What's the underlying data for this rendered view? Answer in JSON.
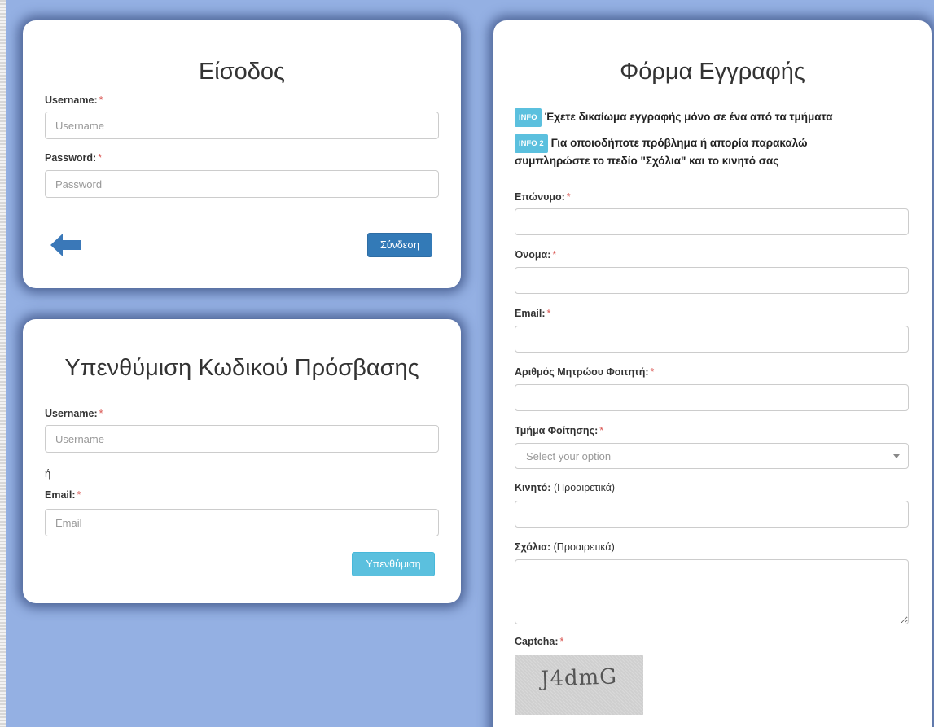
{
  "login": {
    "title": "Είσοδος",
    "username_label": "Username:",
    "username_placeholder": "Username",
    "password_label": "Password:",
    "password_placeholder": "Password",
    "submit_label": "Σύνδεση",
    "required_mark": "*"
  },
  "reminder": {
    "title": "Υπενθύμιση Κωδικού Πρόσβασης",
    "username_label": "Username:",
    "username_placeholder": "Username",
    "or_text": "ή",
    "email_label": "Email:",
    "email_placeholder": "Email",
    "submit_label": "Υπενθύμιση",
    "required_mark": "*"
  },
  "register": {
    "title": "Φόρμα Εγγραφής",
    "info1_badge": "INFO",
    "info1_text": "Έχετε δικαίωμα εγγραφής μόνο σε ένα από τα τμήματα",
    "info2_badge": "INFO 2",
    "info2_text": "Για οποιοδήποτε πρόβλημα ή απορία παρακαλώ συμπληρώστε το πεδίο \"Σχόλια\" και το κινητό σας",
    "required_mark": "*",
    "optional_note": "(Προαιρετικά)",
    "surname_label": "Επώνυμο:",
    "name_label": "Όνομα:",
    "email_label": "Email:",
    "student_id_label": "Αριθμός Μητρώου Φοιτητή:",
    "department_label": "Τμήμα Φοίτησης:",
    "department_selected": "Select your option",
    "mobile_label": "Κινητό:",
    "comments_label": "Σχόλια:",
    "captcha_label": "Captcha:",
    "captcha_text": "J4dmG"
  },
  "colors": {
    "background": "#94b0e3",
    "primary_button": "#337ab7",
    "info_button": "#5bc0de",
    "required_asterisk": "#d9534f"
  },
  "icons": {
    "back": "arrow-left-icon",
    "select_caret": "caret-down-icon"
  }
}
